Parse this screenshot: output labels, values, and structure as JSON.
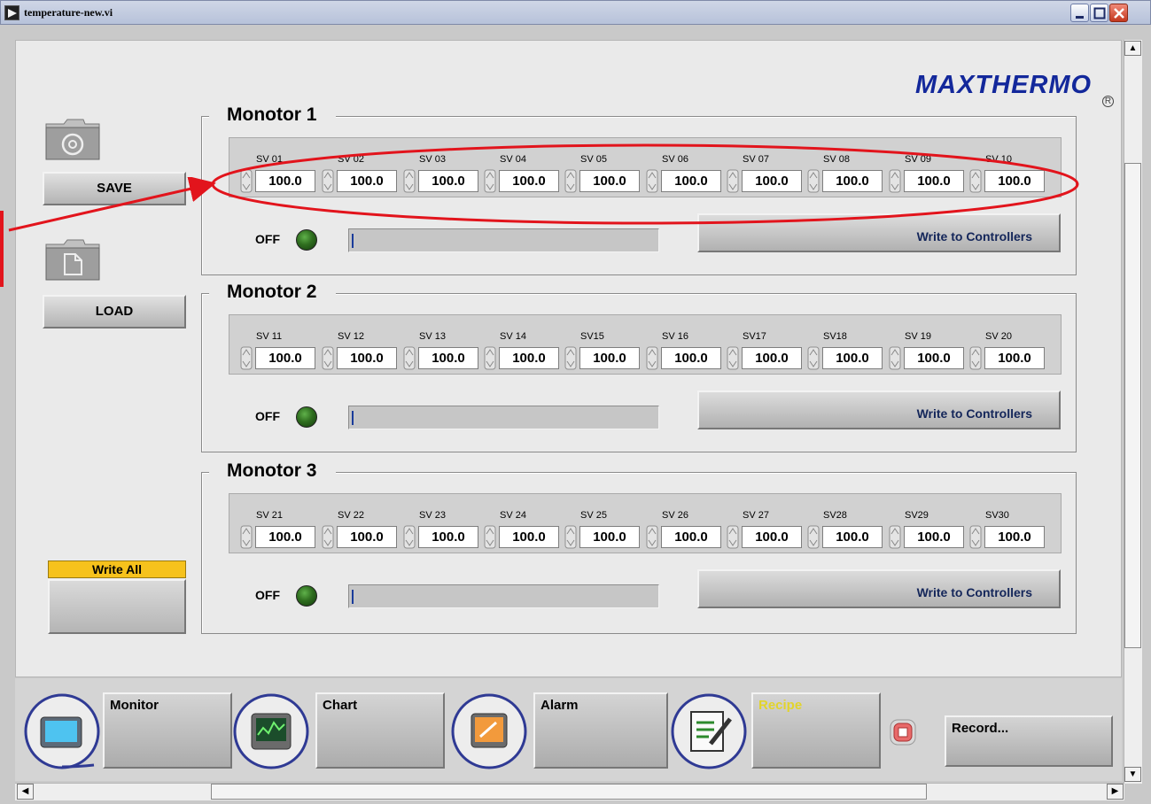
{
  "window": {
    "title": "temperature-new.vi"
  },
  "brand": {
    "name": "MAXTHERMO",
    "mark": "R"
  },
  "side": {
    "save_label": "SAVE",
    "load_label": "LOAD",
    "write_all_label": "Write All"
  },
  "monitors": [
    {
      "title": "Monotor 1",
      "sv_labels": [
        "SV 01",
        "SV 02",
        "SV 03",
        "SV 04",
        "SV 05",
        "SV 06",
        "SV 07",
        "SV 08",
        "SV 09",
        "SV 10"
      ],
      "sv_values": [
        "100.0",
        "100.0",
        "100.0",
        "100.0",
        "100.0",
        "100.0",
        "100.0",
        "100.0",
        "100.0",
        "100.0"
      ],
      "status": "OFF",
      "progress": 0,
      "write_label": "Write to Controllers"
    },
    {
      "title": "Monotor 2",
      "sv_labels": [
        "SV 11",
        "SV 12",
        "SV 13",
        "SV 14",
        "SV15",
        "SV 16",
        "SV17",
        "SV18",
        "SV 19",
        "SV 20"
      ],
      "sv_values": [
        "100.0",
        "100.0",
        "100.0",
        "100.0",
        "100.0",
        "100.0",
        "100.0",
        "100.0",
        "100.0",
        "100.0"
      ],
      "status": "OFF",
      "progress": 0,
      "write_label": "Write to Controllers"
    },
    {
      "title": "Monotor 3",
      "sv_labels": [
        "SV 21",
        "SV 22",
        "SV 23",
        "SV 24",
        "SV 25",
        "SV 26",
        "SV 27",
        "SV28",
        "SV29",
        "SV30"
      ],
      "sv_values": [
        "100.0",
        "100.0",
        "100.0",
        "100.0",
        "100.0",
        "100.0",
        "100.0",
        "100.0",
        "100.0",
        "100.0"
      ],
      "status": "OFF",
      "progress": 0,
      "write_label": "Write to Controllers"
    }
  ],
  "nav": {
    "items": [
      {
        "label": "Monitor",
        "icon": "monitor-icon"
      },
      {
        "label": "Chart",
        "icon": "chart-icon"
      },
      {
        "label": "Alarm",
        "icon": "alarm-icon"
      },
      {
        "label": "Recipe",
        "icon": "recipe-icon"
      }
    ],
    "record_label": "Record...",
    "record_icon": "record-icon"
  },
  "colors": {
    "brand": "#13289b",
    "led_off": "#2f6e1f",
    "write_all_bg": "#f6c21c",
    "annotation": "#e2141c",
    "recipe_text": "#e2d42a"
  }
}
